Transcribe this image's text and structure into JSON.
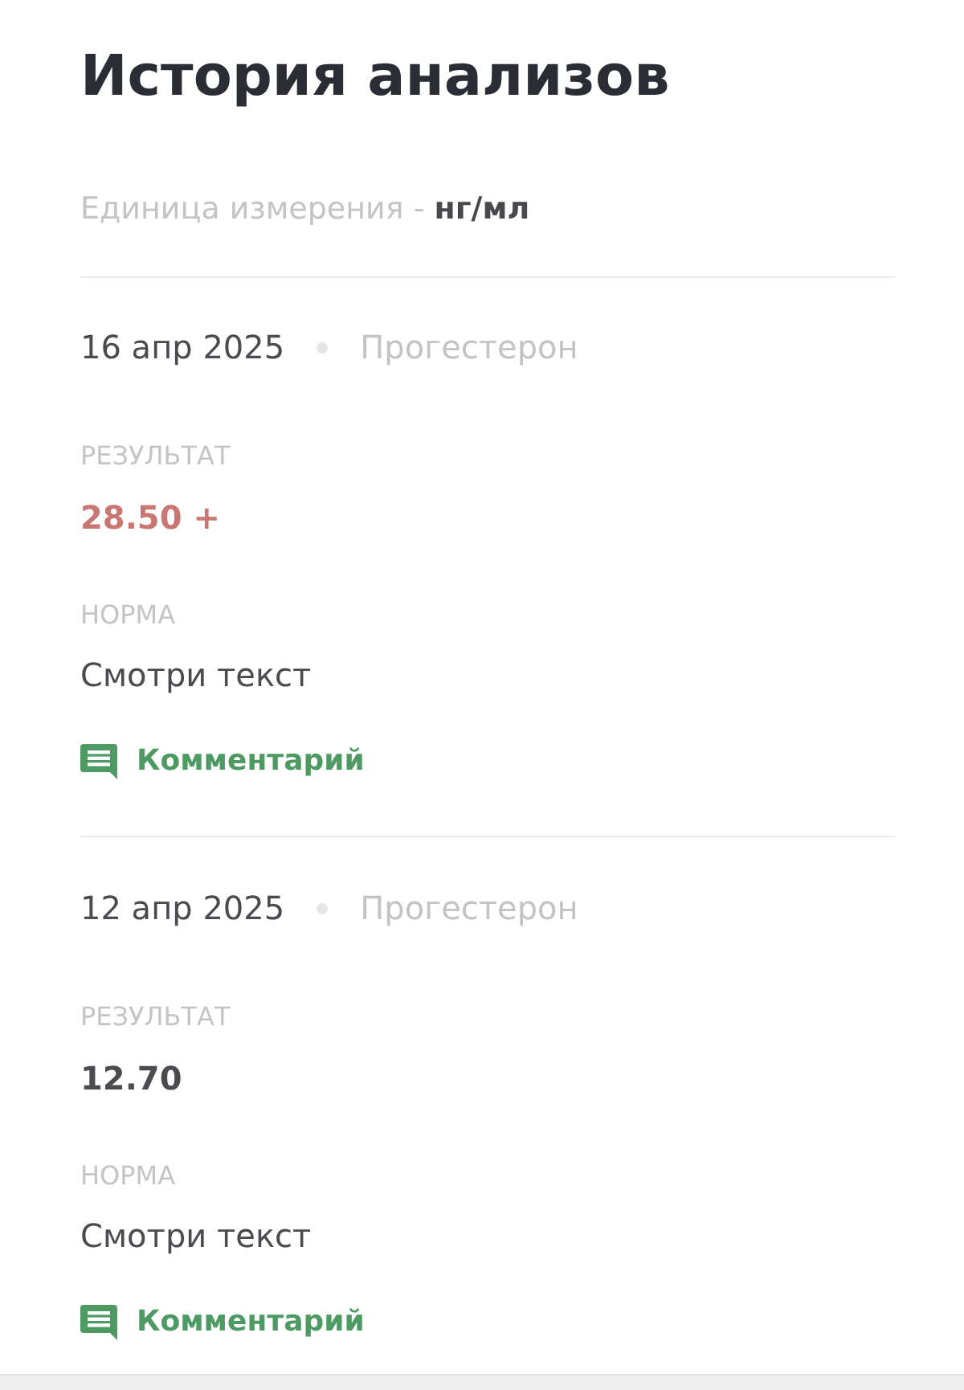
{
  "title": "История анализов",
  "unit": "Единица измерения - **нг/мл**",
  "records": [
    {
      "date": "16 апр 2025",
      "test": "Прогестерон",
      "result_label": "РЕЗУЛЬТАТ",
      "result": "28.50 +",
      "abnormal": true,
      "norm_label": "НОРМА",
      "norm": "Смотри текст",
      "comment": "Комментарий"
    },
    {
      "date": "12 апр 2025",
      "test": "Прогестерон",
      "result_label": "РЕЗУЛЬТАТ",
      "result": "12.70",
      "abnormal": false,
      "norm_label": "НОРМА",
      "norm": "Смотри текст",
      "comment": "Комментарий"
    }
  ]
}
